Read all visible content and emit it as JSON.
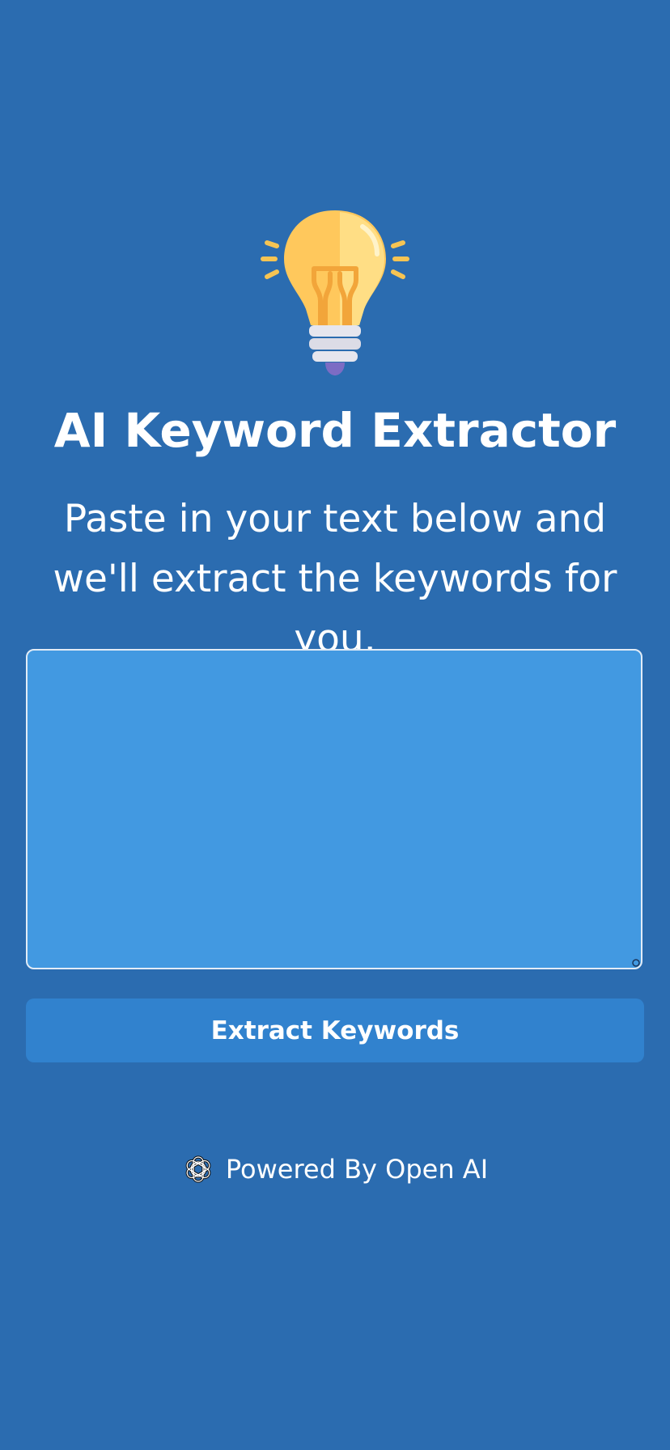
{
  "header": {
    "icon": "lightbulb-icon",
    "title": "AI Keyword Extractor",
    "subtitle": "Paste in your text below and we'll extract the keywords for you."
  },
  "input": {
    "value": "",
    "placeholder": ""
  },
  "actions": {
    "extract_label": "Extract Keywords"
  },
  "footer": {
    "icon": "openai-logo-icon",
    "text": "Powered By Open AI"
  },
  "colors": {
    "background": "#2b6cb0",
    "textarea_bg": "#4299e1",
    "button_bg": "#3182ce",
    "text": "#ffffff"
  }
}
